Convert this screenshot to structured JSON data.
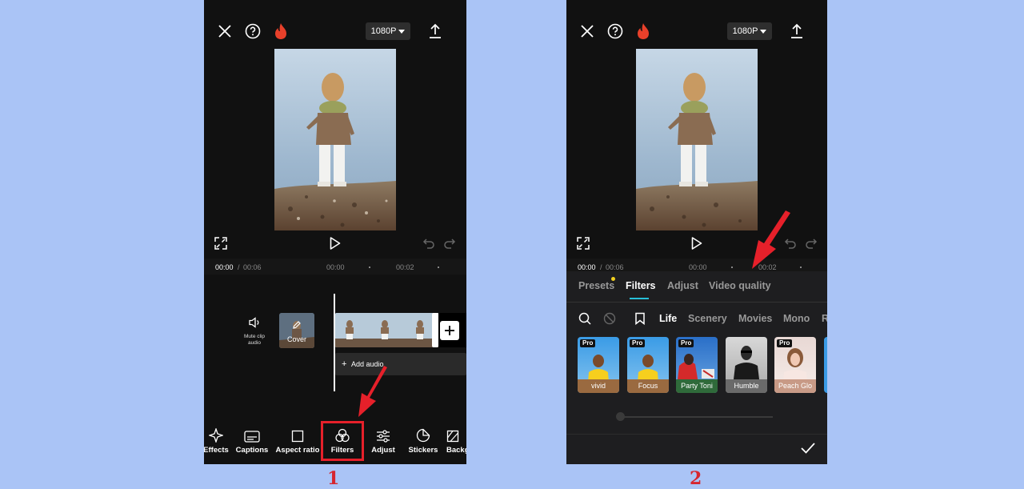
{
  "phone1": {
    "resolution": "1080P",
    "timecode_current": "00:00",
    "timecode_sep": "/",
    "timecode_total": "00:06",
    "ruler": [
      "00:00",
      "00:02"
    ],
    "mute_label": "Mute clip audio",
    "cover_label": "Cover",
    "add_audio": "Add audio",
    "toolbar": [
      {
        "label": "Effects",
        "icon": "sparkle-icon"
      },
      {
        "label": "Captions",
        "icon": "captions-icon"
      },
      {
        "label": "Aspect ratio",
        "icon": "aspect-icon"
      },
      {
        "label": "Filters",
        "icon": "filters-icon"
      },
      {
        "label": "Adjust",
        "icon": "adjust-icon"
      },
      {
        "label": "Stickers",
        "icon": "stickers-icon"
      },
      {
        "label": "Backg",
        "icon": "background-icon"
      }
    ],
    "step": "1"
  },
  "phone2": {
    "resolution": "1080P",
    "timecode_current": "00:00",
    "timecode_sep": "/",
    "timecode_total": "00:06",
    "ruler": [
      "00:00",
      "00:02"
    ],
    "tabs": [
      "Presets",
      "Filters",
      "Adjust",
      "Video quality"
    ],
    "active_tab": "Filters",
    "categories": [
      "Life",
      "Scenery",
      "Movies",
      "Mono",
      "R"
    ],
    "active_category": "Life",
    "filters": [
      {
        "name": "vivid",
        "pro": true,
        "pro_label": "Pro"
      },
      {
        "name": "Focus",
        "pro": true,
        "pro_label": "Pro"
      },
      {
        "name": "Party Toni",
        "pro": true,
        "pro_label": "Pro"
      },
      {
        "name": "Humble",
        "pro": false,
        "pro_label": ""
      },
      {
        "name": "Peach Glo",
        "pro": true,
        "pro_label": "Pro"
      }
    ],
    "step": "2"
  },
  "colors": {
    "background": "#aac4f6",
    "accent_red": "#e6202a",
    "active_tab_underline": "#27c0d8",
    "dot_yellow": "#f2d01f"
  }
}
